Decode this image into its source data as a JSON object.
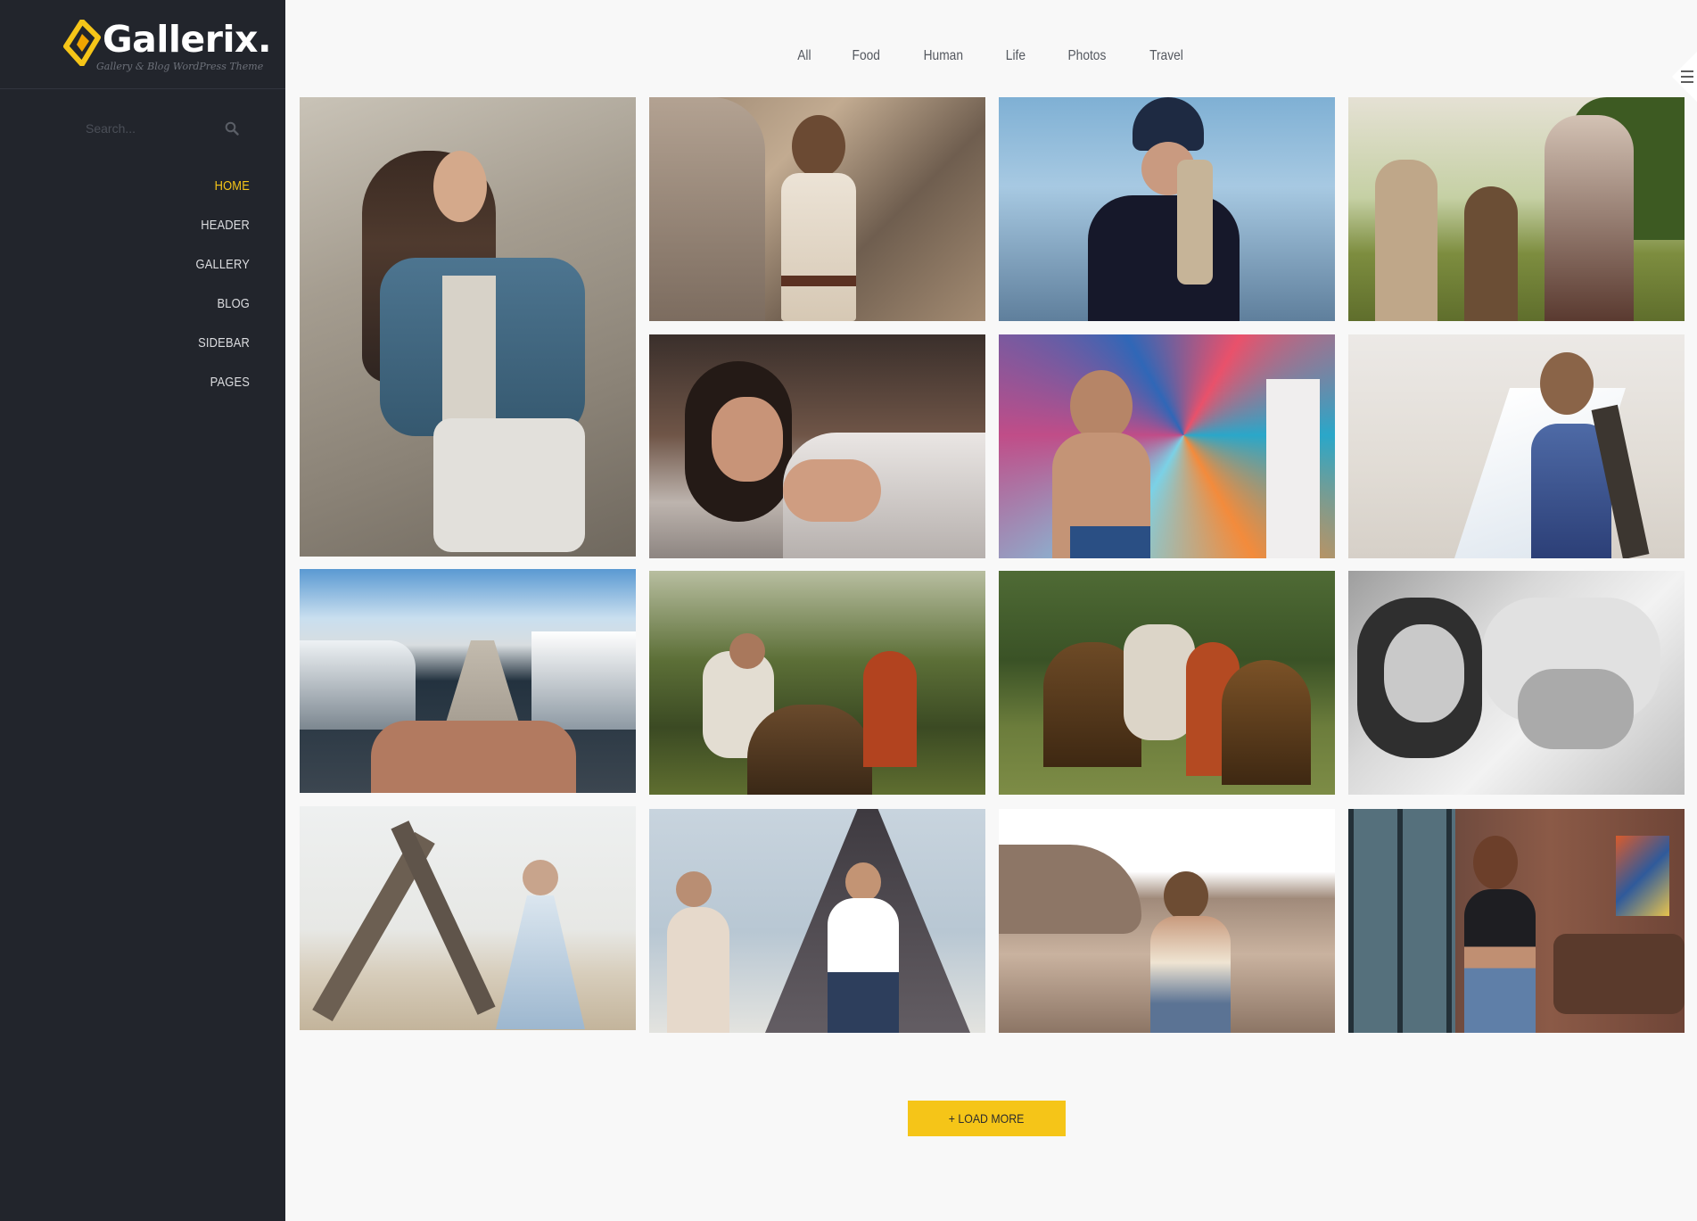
{
  "brand": {
    "name": "Gallerix.",
    "tagline": "Gallery & Blog WordPress Theme",
    "accent": "#f5c518"
  },
  "search": {
    "placeholder": "Search...",
    "icon": "search-icon"
  },
  "nav": {
    "items": [
      {
        "label": "HOME",
        "active": true
      },
      {
        "label": "HEADER",
        "active": false
      },
      {
        "label": "GALLERY",
        "active": false
      },
      {
        "label": "BLOG",
        "active": false
      },
      {
        "label": "SIDEBAR",
        "active": false
      },
      {
        "label": "PAGES",
        "active": false
      }
    ]
  },
  "filters": [
    "All",
    "Food",
    "Human",
    "Life",
    "Photos",
    "Travel"
  ],
  "menu_toggle": {
    "icon": "hamburger-icon"
  },
  "gallery": {
    "tiles": [
      {
        "subject": "woman in denim jacket"
      },
      {
        "subject": "woman on rocks"
      },
      {
        "subject": "woman with beanie and dreadlocks"
      },
      {
        "subject": "three women in field with guitar"
      },
      {
        "subject": "woman in glasses in bed"
      },
      {
        "subject": "man with violin and graffiti"
      },
      {
        "subject": "woman in blue dress with veil"
      },
      {
        "subject": "marina pier with feet"
      },
      {
        "subject": "couple with dog in forest"
      },
      {
        "subject": "couple with two shepherd dogs"
      },
      {
        "subject": "black and white portrait"
      },
      {
        "subject": "woman on beach with driftwood"
      },
      {
        "subject": "couple by teepee"
      },
      {
        "subject": "woman crouching on rocks"
      },
      {
        "subject": "woman by window in brick room"
      }
    ]
  },
  "load_more": {
    "label": "+ LOAD MORE"
  }
}
